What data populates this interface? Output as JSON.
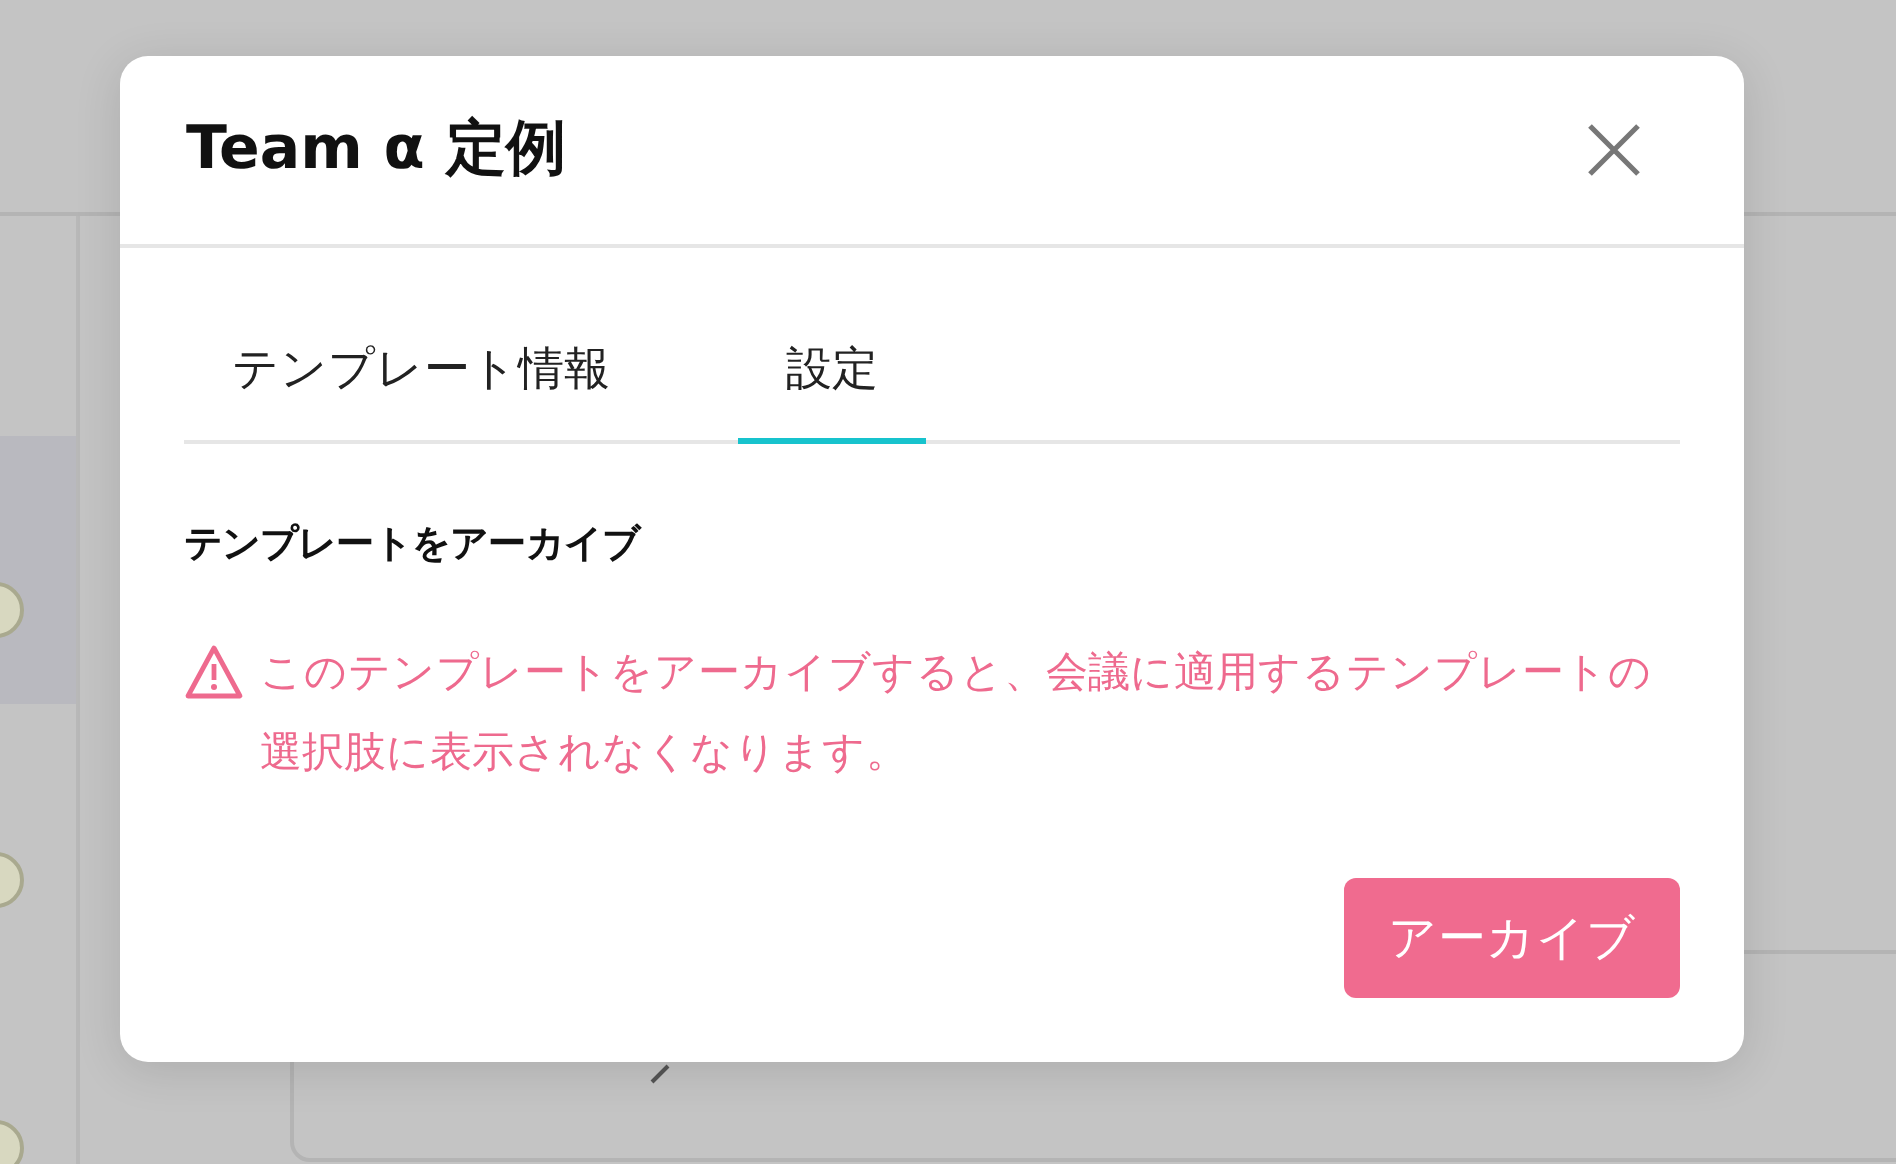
{
  "dialog": {
    "title": "Team α 定例",
    "tabs": [
      {
        "label": "テンプレート情報",
        "selected": false
      },
      {
        "label": "設定",
        "selected": true
      }
    ],
    "section_title": "テンプレートをアーカイブ",
    "warning": "このテンプレートをアーカイブすると、会議に適用するテンプレートの選択肢に表示されなくなります。",
    "button": "アーカイブ"
  }
}
